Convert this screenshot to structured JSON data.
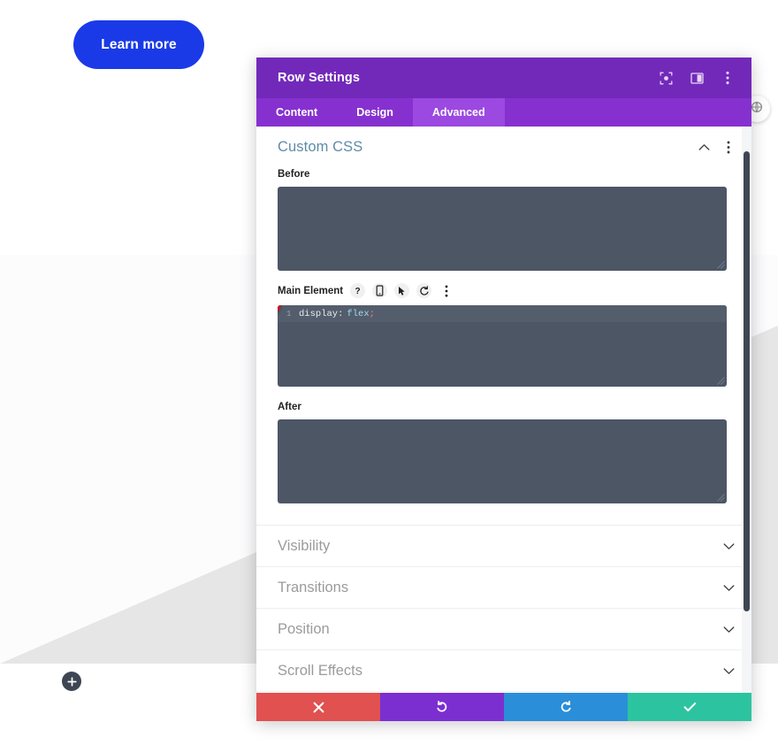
{
  "page": {
    "learn_more_label": "Learn more",
    "add_button_icon": "plus-icon",
    "edge_circle_icon": "settings-circle-icon"
  },
  "modal": {
    "title": "Row Settings",
    "header_icons": [
      {
        "name": "focus-target-icon",
        "label": "Focus"
      },
      {
        "name": "layout-panel-icon",
        "label": "Panel Layout"
      },
      {
        "name": "more-vertical-icon",
        "label": "More Options"
      }
    ],
    "tabs": [
      {
        "label": "Content",
        "active": false
      },
      {
        "label": "Design",
        "active": false
      },
      {
        "label": "Advanced",
        "active": true
      }
    ],
    "open_section": {
      "title": "Custom CSS",
      "collapse_icon": "chevron-up-icon",
      "more_icon": "more-vertical-icon"
    },
    "fields": [
      {
        "label": "Before",
        "value": "",
        "name": "before-css-textarea"
      },
      {
        "label": "Main Element",
        "value": "display: flex;",
        "name": "main-element-css-editor",
        "line_number": "1",
        "code": {
          "property": "display",
          "colon": ":",
          "value": "flex",
          "semicolon": ";"
        },
        "toolbar_icons": [
          {
            "name": "help-icon",
            "glyph": "?"
          },
          {
            "name": "responsive-device-icon",
            "glyph": "device"
          },
          {
            "name": "hover-cursor-icon",
            "glyph": "cursor"
          },
          {
            "name": "reset-icon",
            "glyph": "undo"
          },
          {
            "name": "more-vertical-icon",
            "glyph": "dots"
          }
        ],
        "badge": "1"
      },
      {
        "label": "After",
        "value": "",
        "name": "after-css-textarea"
      }
    ],
    "collapsed_sections": [
      {
        "label": "Visibility"
      },
      {
        "label": "Transitions"
      },
      {
        "label": "Position"
      },
      {
        "label": "Scroll Effects"
      }
    ],
    "actions": [
      {
        "name": "cancel-button",
        "icon": "close-icon",
        "color": "#e0514f"
      },
      {
        "name": "undo-button",
        "icon": "undo-icon",
        "color": "#7b2fd0"
      },
      {
        "name": "redo-button",
        "icon": "redo-icon",
        "color": "#2a8fd8"
      },
      {
        "name": "save-button",
        "icon": "check-icon",
        "color": "#2cc4a0"
      }
    ]
  },
  "colors": {
    "header_purple": "#7229ba",
    "tabs_purple": "#8631cf",
    "tab_active_purple": "#9b49e0",
    "code_bg": "#4d5665",
    "section_title_blue": "#5d8ca8",
    "badge_red": "#c9171e",
    "learn_more_blue": "#1a3ae8"
  }
}
